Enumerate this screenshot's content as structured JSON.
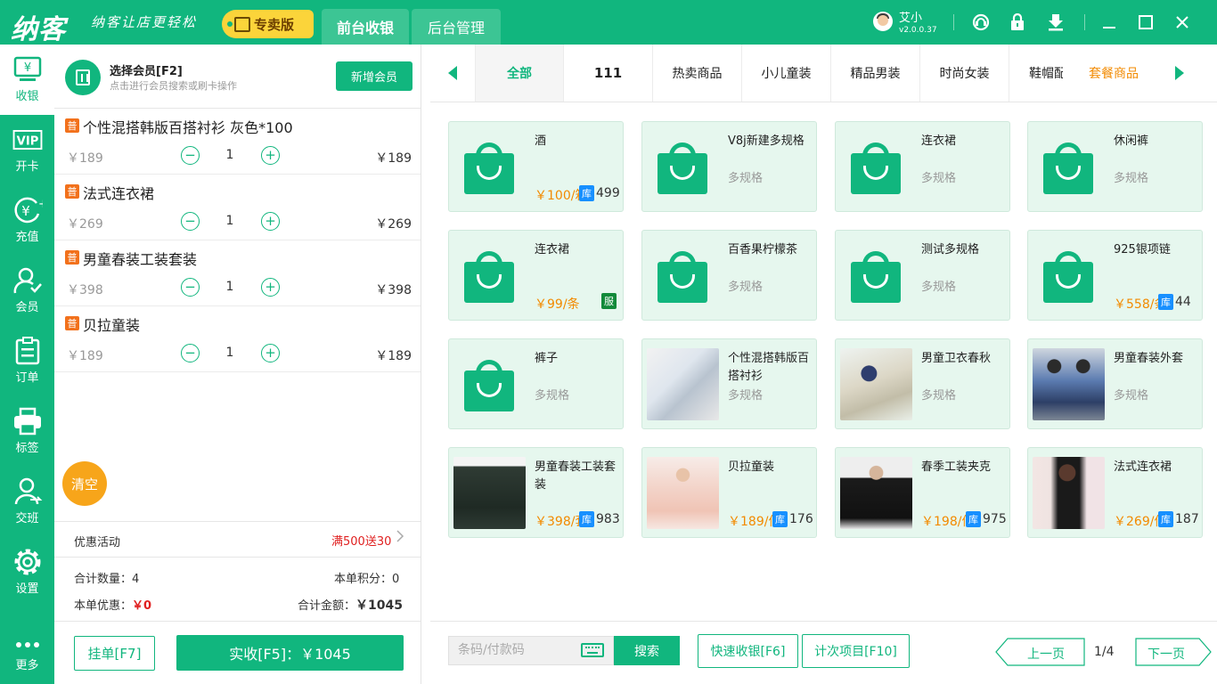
{
  "app": {
    "logo": "纳客",
    "slogan": "纳客让店更轻松",
    "edition": "专卖版",
    "tabs": [
      "前台收银",
      "后台管理"
    ],
    "user": {
      "name": "艾小",
      "version": "v2.0.0.37"
    }
  },
  "nav": [
    {
      "label": "收银",
      "icon": "cashier-icon"
    },
    {
      "label": "开卡",
      "icon": "vip-card-icon"
    },
    {
      "label": "充值",
      "icon": "recharge-icon"
    },
    {
      "label": "会员",
      "icon": "member-icon"
    },
    {
      "label": "订单",
      "icon": "order-icon"
    },
    {
      "label": "标签",
      "icon": "printer-icon"
    },
    {
      "label": "交班",
      "icon": "shift-icon"
    },
    {
      "label": "设置",
      "icon": "gear-icon"
    },
    {
      "label": "更多",
      "icon": "more-icon"
    }
  ],
  "member": {
    "title": "选择会员[F2]",
    "hint": "点击进行会员搜索或刷卡操作",
    "new_button": "新增会员"
  },
  "cart": {
    "items": [
      {
        "tag": "普",
        "name": "个性混搭韩版百搭衬衫 灰色*100",
        "price": "￥189",
        "qty": "1",
        "subtotal": "￥189",
        "minus": "−",
        "plus": "+"
      },
      {
        "tag": "普",
        "name": "法式连衣裙",
        "price": "￥269",
        "qty": "1",
        "subtotal": "￥269",
        "minus": "−",
        "plus": "+"
      },
      {
        "tag": "普",
        "name": "男童春装工装套装",
        "price": "￥398",
        "qty": "1",
        "subtotal": "￥398",
        "minus": "−",
        "plus": "+"
      },
      {
        "tag": "普",
        "name": "贝拉童装",
        "price": "￥189",
        "qty": "1",
        "subtotal": "￥189",
        "minus": "−",
        "plus": "+"
      }
    ],
    "clear": "清空",
    "promo_label": "优惠活动",
    "promo_value": "满500送30",
    "total_qty_label": "合计数量：",
    "total_qty": "4",
    "points_label": "本单积分：",
    "points": "0",
    "discount_label": "本单优惠：",
    "discount": "￥0",
    "total_amount_label": "合计金额：",
    "total_amount": "￥1045",
    "hold_button": "挂单[F7]",
    "pay_button": "实收[F5]：￥1045"
  },
  "categories": [
    "全部",
    "111",
    "热卖商品",
    "小儿童装",
    "精品男装",
    "时尚女装",
    "鞋帽配饰",
    "套餐商品"
  ],
  "products": [
    {
      "name": "酒",
      "spec": "",
      "price": "￥100/箱",
      "stock_tag": "库",
      "stock": "499",
      "image": "bag"
    },
    {
      "name": "V8j新建多规格",
      "spec": "多规格",
      "price": "",
      "stock_tag": "",
      "stock": "",
      "image": "bag"
    },
    {
      "name": "连衣裙",
      "spec": "多规格",
      "price": "",
      "stock_tag": "",
      "stock": "",
      "image": "bag"
    },
    {
      "name": "休闲裤",
      "spec": "多规格",
      "price": "",
      "stock_tag": "",
      "stock": "",
      "image": "bag"
    },
    {
      "name": "连衣裙",
      "spec": "",
      "price": "￥99/条",
      "stock_tag": "服",
      "stock": "",
      "image": "bag"
    },
    {
      "name": "百香果柠檬茶",
      "spec": "多规格",
      "price": "",
      "stock_tag": "",
      "stock": "",
      "image": "bag"
    },
    {
      "name": "测试多规格",
      "spec": "多规格",
      "price": "",
      "stock_tag": "",
      "stock": "",
      "image": "bag"
    },
    {
      "name": "925银项链",
      "spec": "",
      "price": "￥558/条",
      "stock_tag": "库",
      "stock": "44",
      "image": "bag"
    },
    {
      "name": "裤子",
      "spec": "多规格",
      "price": "",
      "stock_tag": "",
      "stock": "",
      "image": "bag"
    },
    {
      "name": "个性混搭韩版百搭衬衫",
      "spec": "多规格",
      "price": "",
      "stock_tag": "",
      "stock": "",
      "image": "photo-shirt"
    },
    {
      "name": "男童卫衣春秋",
      "spec": "多规格",
      "price": "",
      "stock_tag": "",
      "stock": "",
      "image": "photo-hoodie"
    },
    {
      "name": "男童春装外套",
      "spec": "多规格",
      "price": "",
      "stock_tag": "",
      "stock": "",
      "image": "photo-jacket"
    },
    {
      "name": "男童春装工装套装",
      "spec": "",
      "price": "￥398/套",
      "stock_tag": "库",
      "stock": "983",
      "image": "photo-workwear"
    },
    {
      "name": "贝拉童装",
      "spec": "",
      "price": "￥189/件",
      "stock_tag": "库",
      "stock": "176",
      "image": "photo-girl-dress"
    },
    {
      "name": "春季工装夹克",
      "spec": "",
      "price": "￥198/件",
      "stock_tag": "库",
      "stock": "975",
      "image": "photo-black-jacket"
    },
    {
      "name": "法式连衣裙",
      "spec": "",
      "price": "￥269/件",
      "stock_tag": "库",
      "stock": "187",
      "image": "photo-dress"
    }
  ],
  "bottom": {
    "barcode_placeholder": "条码/付款码",
    "search": "搜索",
    "quick_cashier": "快速收银[F6]",
    "count_item": "计次项目[F10]",
    "prev_page": "上一页",
    "page": "1/4",
    "next_page": "下一页"
  },
  "colors": {
    "brand": "#11b67e",
    "orange": "#f7a51a",
    "price": "#f28a00",
    "stock_badge": "#1890ff",
    "promo": "#e02020"
  }
}
